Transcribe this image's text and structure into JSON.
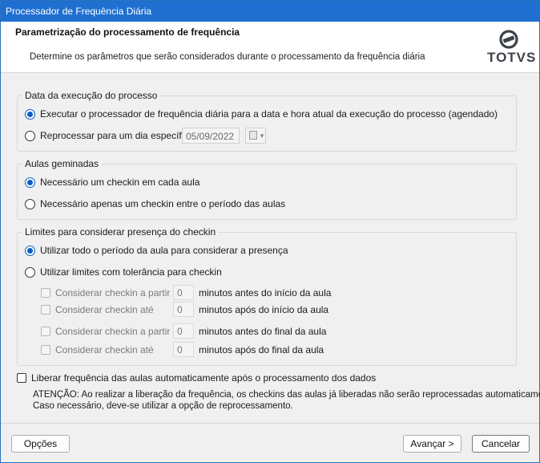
{
  "window": {
    "title": "Processador de Frequência Diária"
  },
  "header": {
    "title": "Parametrização do processamento de frequência",
    "description": "Determine os parâmetros que serão considerados durante o processamento da frequência diária",
    "logo_text": "TOTVS"
  },
  "execution_date": {
    "label": "Data da execução do processo",
    "option_current": "Executar o processador de frequência diária para a data e hora atual da execução do processo (agendado)",
    "option_specific": "Reprocessar para um dia específico:",
    "date_value": "05/09/2022",
    "selected": "current"
  },
  "combined_classes": {
    "label": "Aulas geminadas",
    "option_each": "Necessário um checkin em cada aula",
    "option_single": "Necessário apenas um checkin entre o período das aulas",
    "selected": "each"
  },
  "presence_limits": {
    "label": "Limites para considerar presença do checkin",
    "option_full": "Utilizar todo o período da aula para considerar a presença",
    "option_tolerance": "Utilizar limites com tolerância para checkin",
    "selected": "full",
    "rows": [
      {
        "label": "Considerar checkin a partir de",
        "value": "0",
        "suffix": "minutos antes do início da aula"
      },
      {
        "label": "Considerar checkin até",
        "value": "0",
        "suffix": "minutos após do início da aula"
      },
      {
        "label": "Considerar checkin a partir de",
        "value": "0",
        "suffix": "minutos antes do final da aula"
      },
      {
        "label": "Considerar checkin até",
        "value": "0",
        "suffix": "minutos após do final da aula"
      }
    ]
  },
  "release": {
    "label": "Liberar frequência das aulas automaticamente após o processamento dos dados",
    "checked": false,
    "note_line1": "ATENÇÃO: Ao realizar a liberação da frequência, os checkins das aulas já liberadas não serão reprocessadas automaticamente.",
    "note_line2": "Caso necessário, deve-se utilizar a opção de reprocessamento."
  },
  "buttons": {
    "options": "Opções",
    "next": "Avançar >",
    "cancel": "Cancelar"
  },
  "colors": {
    "titlebar": "#1f6fd1",
    "accent": "#0a5fc4",
    "background": "#f0f0f0"
  },
  "icons": {
    "logo": "totvs-logo-icon",
    "calendar": "calendar-icon",
    "dropdown": "chevron-down-icon"
  }
}
